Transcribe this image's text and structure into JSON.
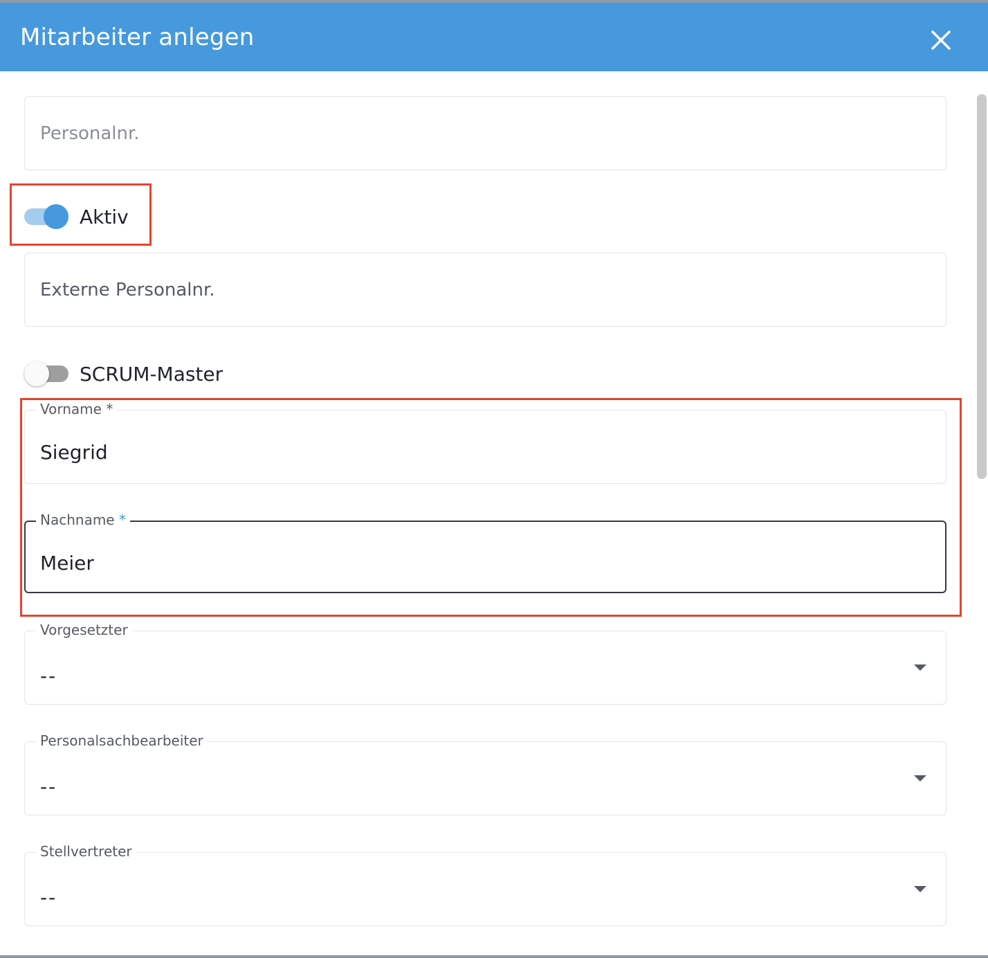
{
  "dialog": {
    "title": "Mitarbeiter anlegen",
    "close_icon": "close-icon"
  },
  "form": {
    "personalnr": {
      "placeholder": "Personalnr."
    },
    "aktiv": {
      "label": "Aktiv",
      "checked": true
    },
    "externe_personalnr": {
      "placeholder": "Externe Personalnr."
    },
    "scrum_master": {
      "label": "SCRUM-Master",
      "checked": false
    },
    "vorname": {
      "label": "Vorname",
      "required_mark": "*",
      "value": "Siegrid"
    },
    "nachname": {
      "label": "Nachname",
      "required_mark": "*",
      "value": "Meier"
    },
    "vorgesetzter": {
      "label": "Vorgesetzter",
      "value": "--"
    },
    "personalsachbearbeiter": {
      "label": "Personalsachbearbeiter",
      "value": "--"
    },
    "stellvertreter": {
      "label": "Stellvertreter",
      "value": "--"
    }
  },
  "colors": {
    "header": "#4699dd",
    "accent": "#4699dd",
    "highlight": "#e2442f"
  }
}
